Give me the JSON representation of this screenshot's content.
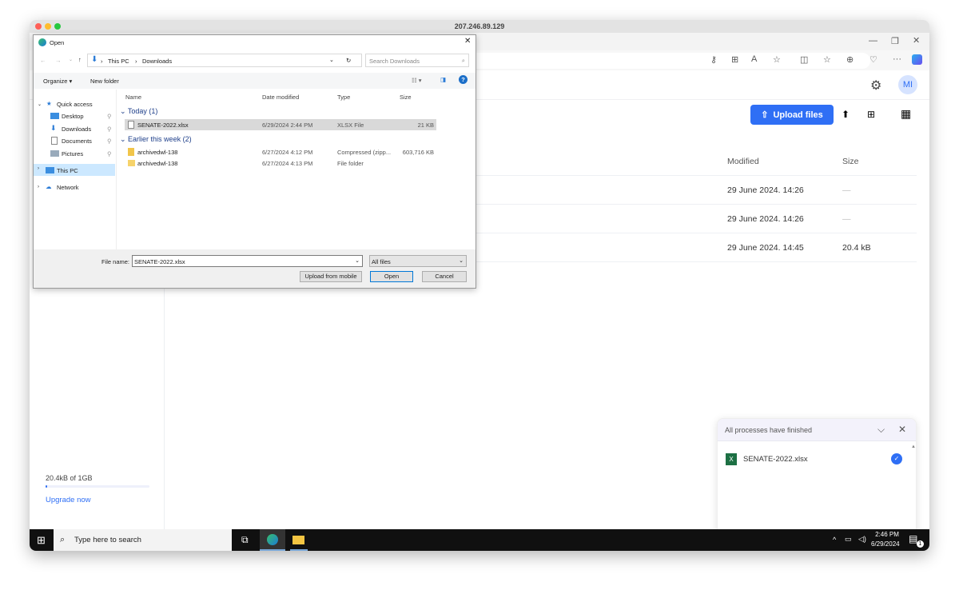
{
  "window": {
    "title": "207.246.89.129"
  },
  "header": {
    "avatar": "MI"
  },
  "toolbar": {
    "upload_label": "Upload files"
  },
  "table": {
    "headers": {
      "modified": "Modified",
      "size": "Size"
    },
    "rows": [
      {
        "modified": "29 June 2024. 14:26",
        "size": "—"
      },
      {
        "modified": "29 June 2024. 14:26",
        "size": "—"
      },
      {
        "modified": "29 June 2024. 14:45",
        "size": "20.4 kB"
      }
    ]
  },
  "sidebar": {
    "storage_text": "20.4kB of 1GB",
    "storage_used_fraction": 2e-05,
    "upgrade_label": "Upgrade now"
  },
  "dialog": {
    "title": "Open",
    "path": [
      "This PC",
      "Downloads"
    ],
    "search_placeholder": "Search Downloads",
    "organize": "Organize",
    "new_folder": "New folder",
    "nav": [
      {
        "label": "Quick access"
      },
      {
        "label": "Desktop"
      },
      {
        "label": "Downloads"
      },
      {
        "label": "Documents"
      },
      {
        "label": "Pictures"
      },
      {
        "label": "This PC"
      },
      {
        "label": "Network"
      }
    ],
    "columns": [
      "Name",
      "Date modified",
      "Type",
      "Size"
    ],
    "groups": [
      {
        "label": "Today (1)",
        "files": [
          {
            "name": "SENATE-2022.xlsx",
            "date": "6/29/2024 2:44 PM",
            "type": "XLSX File",
            "size": "21 KB"
          }
        ]
      },
      {
        "label": "Earlier this week (2)",
        "files": [
          {
            "name": "archivedwl-138",
            "date": "6/27/2024 4:12 PM",
            "type": "Compressed (zipp...",
            "size": "603,716 KB"
          },
          {
            "name": "archivedwl-138",
            "date": "6/27/2024 4:13 PM",
            "type": "File folder",
            "size": ""
          }
        ]
      }
    ],
    "file_name_label": "File name:",
    "file_name_value": "SENATE-2022.xlsx",
    "filter": "All files",
    "upload_mobile": "Upload from mobile",
    "open": "Open",
    "cancel": "Cancel"
  },
  "toast": {
    "title": "All processes have finished",
    "file": "SENATE-2022.xlsx"
  },
  "taskbar": {
    "search_placeholder": "Type here to search",
    "time": "2:46 PM",
    "date": "6/29/2024",
    "notifications": "1"
  }
}
